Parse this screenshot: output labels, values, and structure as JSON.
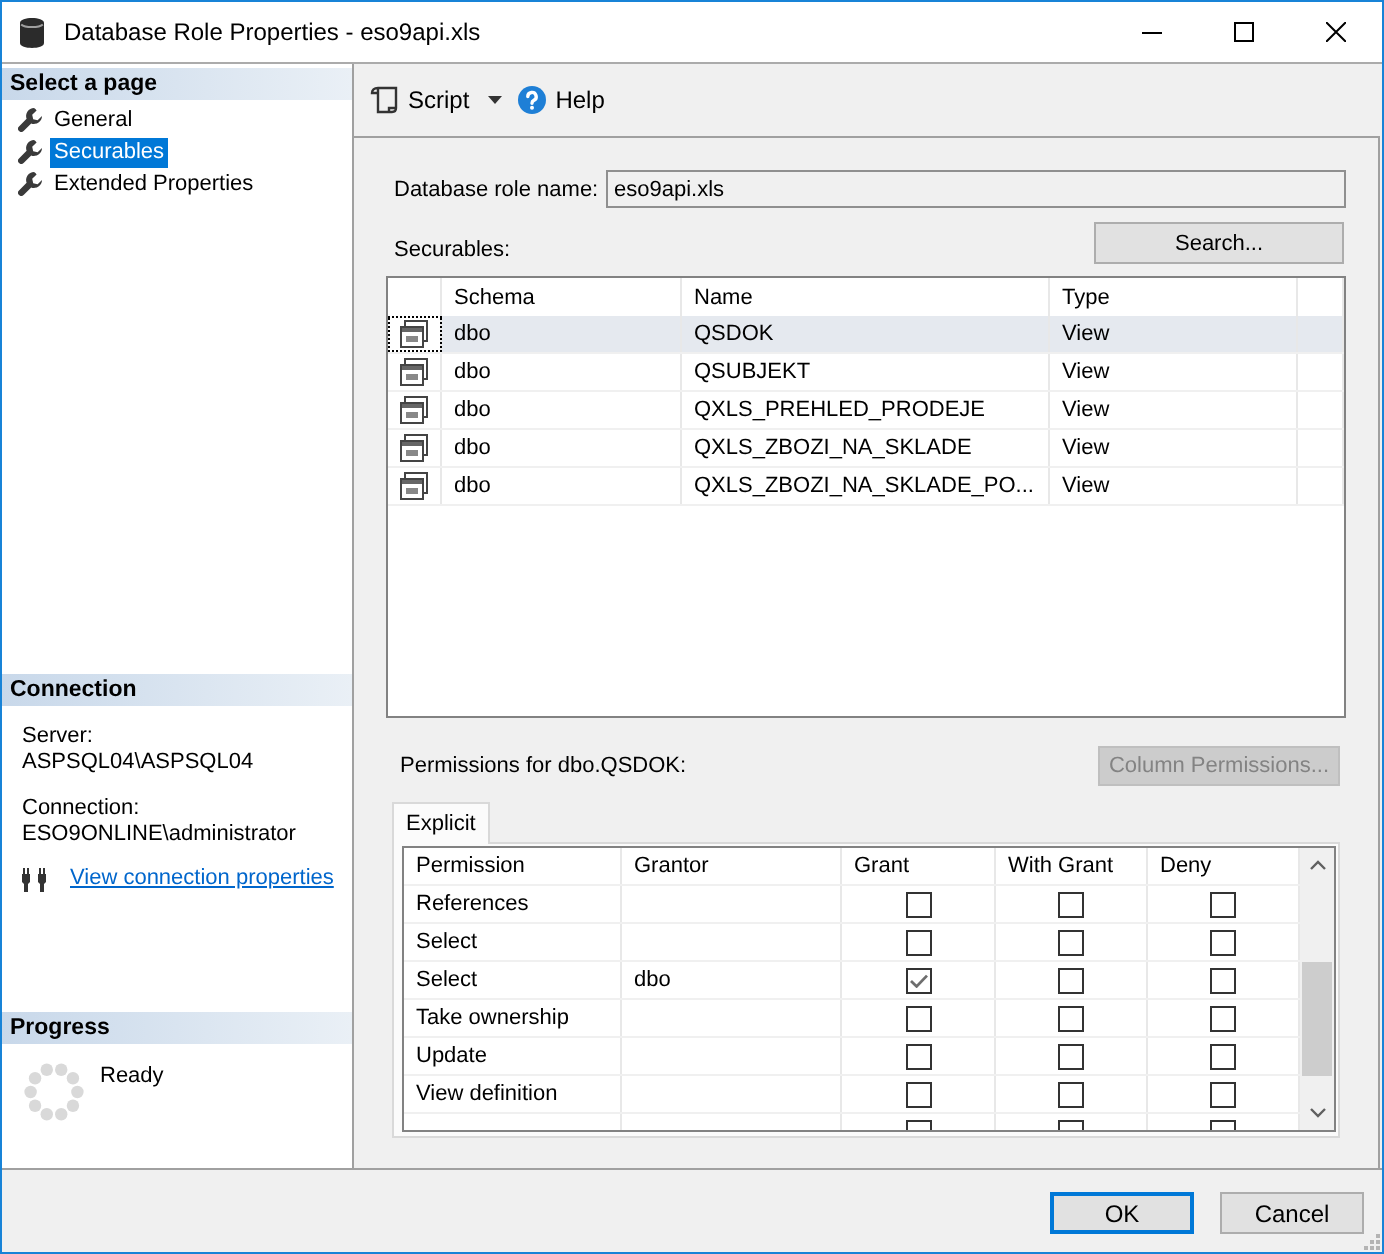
{
  "window": {
    "title": "Database Role Properties - eso9api.xls"
  },
  "sidebar": {
    "select_page": {
      "title": "Select a page",
      "items": [
        {
          "label": "General",
          "selected": false
        },
        {
          "label": "Securables",
          "selected": true
        },
        {
          "label": "Extended Properties",
          "selected": false
        }
      ]
    },
    "connection": {
      "title": "Connection",
      "fields": [
        {
          "label": "Server:",
          "value": "ASPSQL04\\ASPSQL04"
        },
        {
          "label": "Connection:",
          "value": "ESO9ONLINE\\administrator"
        }
      ],
      "link": "View connection properties"
    },
    "progress": {
      "title": "Progress",
      "status": "Ready"
    }
  },
  "toolbar": {
    "script": "Script",
    "help": "Help"
  },
  "role_name": {
    "label": "Database role name:",
    "value": "eso9api.xls"
  },
  "securables": {
    "label": "Securables:",
    "search_button": "Search...",
    "columns": [
      "Schema",
      "Name",
      "Type"
    ],
    "rows": [
      {
        "schema": "dbo",
        "name": "QSDOK",
        "type": "View",
        "selected": true
      },
      {
        "schema": "dbo",
        "name": "QSUBJEKT",
        "type": "View",
        "selected": false
      },
      {
        "schema": "dbo",
        "name": "QXLS_PREHLED_PRODEJE",
        "type": "View",
        "selected": false
      },
      {
        "schema": "dbo",
        "name": "QXLS_ZBOZI_NA_SKLADE",
        "type": "View",
        "selected": false
      },
      {
        "schema": "dbo",
        "name": "QXLS_ZBOZI_NA_SKLADE_PO...",
        "type": "View",
        "selected": false
      }
    ]
  },
  "permissions": {
    "label": "Permissions for dbo.QSDOK:",
    "column_permissions_button": {
      "label": "Column Permissions...",
      "disabled": true
    },
    "tabs": [
      {
        "label": "Explicit",
        "selected": true
      }
    ],
    "columns": [
      "Permission",
      "Grantor",
      "Grant",
      "With Grant",
      "Deny"
    ],
    "rows": [
      {
        "kind": "full",
        "permission": "References",
        "grant": false,
        "with_grant": false,
        "deny": false
      },
      {
        "kind": "full",
        "permission": "Select",
        "grant": false,
        "with_grant": false,
        "deny": false
      },
      {
        "kind": "full",
        "permission": "Select",
        "grantor": "dbo",
        "grant": true,
        "with_grant": false,
        "deny": false
      },
      {
        "kind": "full",
        "permission": "Take ownership",
        "grant": false,
        "with_grant": false,
        "deny": false
      },
      {
        "kind": "full",
        "permission": "Update",
        "grant": false,
        "with_grant": false,
        "deny": false
      },
      {
        "kind": "full",
        "permission": "View definition",
        "grant": false,
        "with_grant": false,
        "deny": false
      },
      {
        "kind": "cut",
        "grant": false,
        "with_grant": false,
        "deny": false
      }
    ]
  },
  "buttons": [
    {
      "label": "OK",
      "default": true
    },
    {
      "label": "Cancel",
      "default": false
    }
  ]
}
